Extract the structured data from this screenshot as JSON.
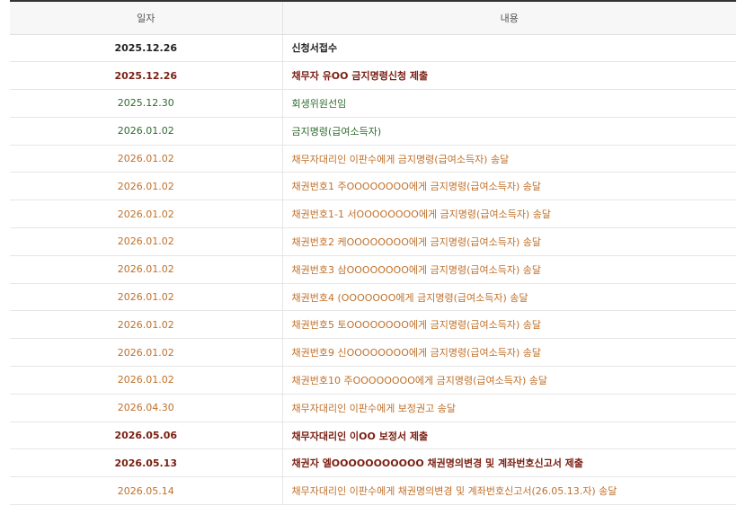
{
  "colors": {
    "black": "#222222",
    "maroon": "#7a1f12",
    "green": "#2e6b2e",
    "orange": "#c0702a"
  },
  "table": {
    "headers": [
      "일자",
      "내용"
    ],
    "rows": [
      {
        "date": "2025.12.26",
        "content": "신청서접수",
        "color": "black",
        "bold": true
      },
      {
        "date": "2025.12.26",
        "content": "채무자 유OO 금지명령신청 제출",
        "color": "maroon",
        "bold": true
      },
      {
        "date": "2025.12.30",
        "content": "회생위원선임",
        "color": "green",
        "bold": false
      },
      {
        "date": "2026.01.02",
        "content": "금지명령(급여소득자)",
        "color": "green",
        "bold": false
      },
      {
        "date": "2026.01.02",
        "content": "채무자대리인 이판수에게 금지명령(급여소득자) 송달",
        "color": "orange",
        "bold": false
      },
      {
        "date": "2026.01.02",
        "content": "채권번호1 주OOOOOOOO에게 금지명령(급여소득자) 송달",
        "color": "orange",
        "bold": false
      },
      {
        "date": "2026.01.02",
        "content": "채권번호1-1 서OOOOOOOO에게 금지명령(급여소득자) 송달",
        "color": "orange",
        "bold": false
      },
      {
        "date": "2026.01.02",
        "content": "채권번호2 케OOOOOOOO에게 금지명령(급여소득자) 송달",
        "color": "orange",
        "bold": false
      },
      {
        "date": "2026.01.02",
        "content": "채권번호3 삼OOOOOOOO에게 금지명령(급여소득자) 송달",
        "color": "orange",
        "bold": false
      },
      {
        "date": "2026.01.02",
        "content": "채권번호4 (OOOOOOO에게 금지명령(급여소득자) 송달",
        "color": "orange",
        "bold": false
      },
      {
        "date": "2026.01.02",
        "content": "채권번호5 토OOOOOOOO에게 금지명령(급여소득자) 송달",
        "color": "orange",
        "bold": false
      },
      {
        "date": "2026.01.02",
        "content": "채권번호9 신OOOOOOOO에게 금지명령(급여소득자) 송달",
        "color": "orange",
        "bold": false
      },
      {
        "date": "2026.01.02",
        "content": "채권번호10 주OOOOOOOO에게 금지명령(급여소득자) 송달",
        "color": "orange",
        "bold": false
      },
      {
        "date": "2026.04.30",
        "content": "채무자대리인 이판수에게 보정권고 송달",
        "color": "orange",
        "bold": false
      },
      {
        "date": "2026.05.06",
        "content": "채무자대리인 이OO 보정서 제출",
        "color": "maroon",
        "bold": true
      },
      {
        "date": "2026.05.13",
        "content": "채권자 엘OOOOOOOOOOO 채권명의변경 및 계좌번호신고서 제출",
        "color": "maroon",
        "bold": true
      },
      {
        "date": "2026.05.14",
        "content": "채무자대리인 이판수에게 채권명의변경 및 계좌번호신고서(26.05.13.자) 송달",
        "color": "orange",
        "bold": false
      }
    ]
  }
}
